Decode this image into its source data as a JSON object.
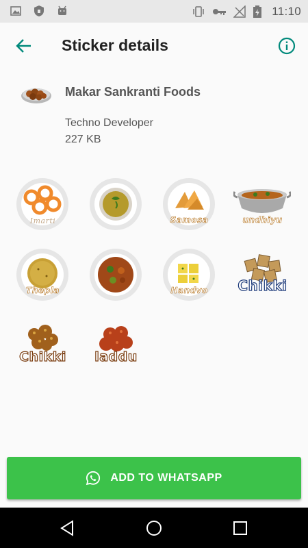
{
  "status_bar": {
    "time": "11:10",
    "left_icons": [
      "image-icon",
      "shield-icon",
      "android-icon"
    ],
    "right_icons": [
      "vibrate-icon",
      "key-icon",
      "signal-icon",
      "battery-charging-icon"
    ]
  },
  "app_bar": {
    "title": "Sticker details",
    "back_icon": "arrow-left-icon",
    "info_icon": "info-icon",
    "accent": "#00897b"
  },
  "pack": {
    "name": "Makar Sankranti Foods",
    "publisher": "Techno Developer",
    "size": "227 KB"
  },
  "stickers": [
    {
      "name": "imarti",
      "label": "Imarti"
    },
    {
      "name": "dal",
      "label": ""
    },
    {
      "name": "samosa",
      "label": "Samosa"
    },
    {
      "name": "undhiyu",
      "label": "undhiyu"
    },
    {
      "name": "thepla",
      "label": "Thepla"
    },
    {
      "name": "mixed-plate",
      "label": ""
    },
    {
      "name": "handvo",
      "label": "Handvo"
    },
    {
      "name": "chikki",
      "label": "Chikki"
    },
    {
      "name": "chikki-2",
      "label": "Chikki"
    },
    {
      "name": "laddu",
      "label": "laddu"
    }
  ],
  "action": {
    "add_label": "ADD TO WHATSAPP",
    "color": "#3cc24a"
  }
}
